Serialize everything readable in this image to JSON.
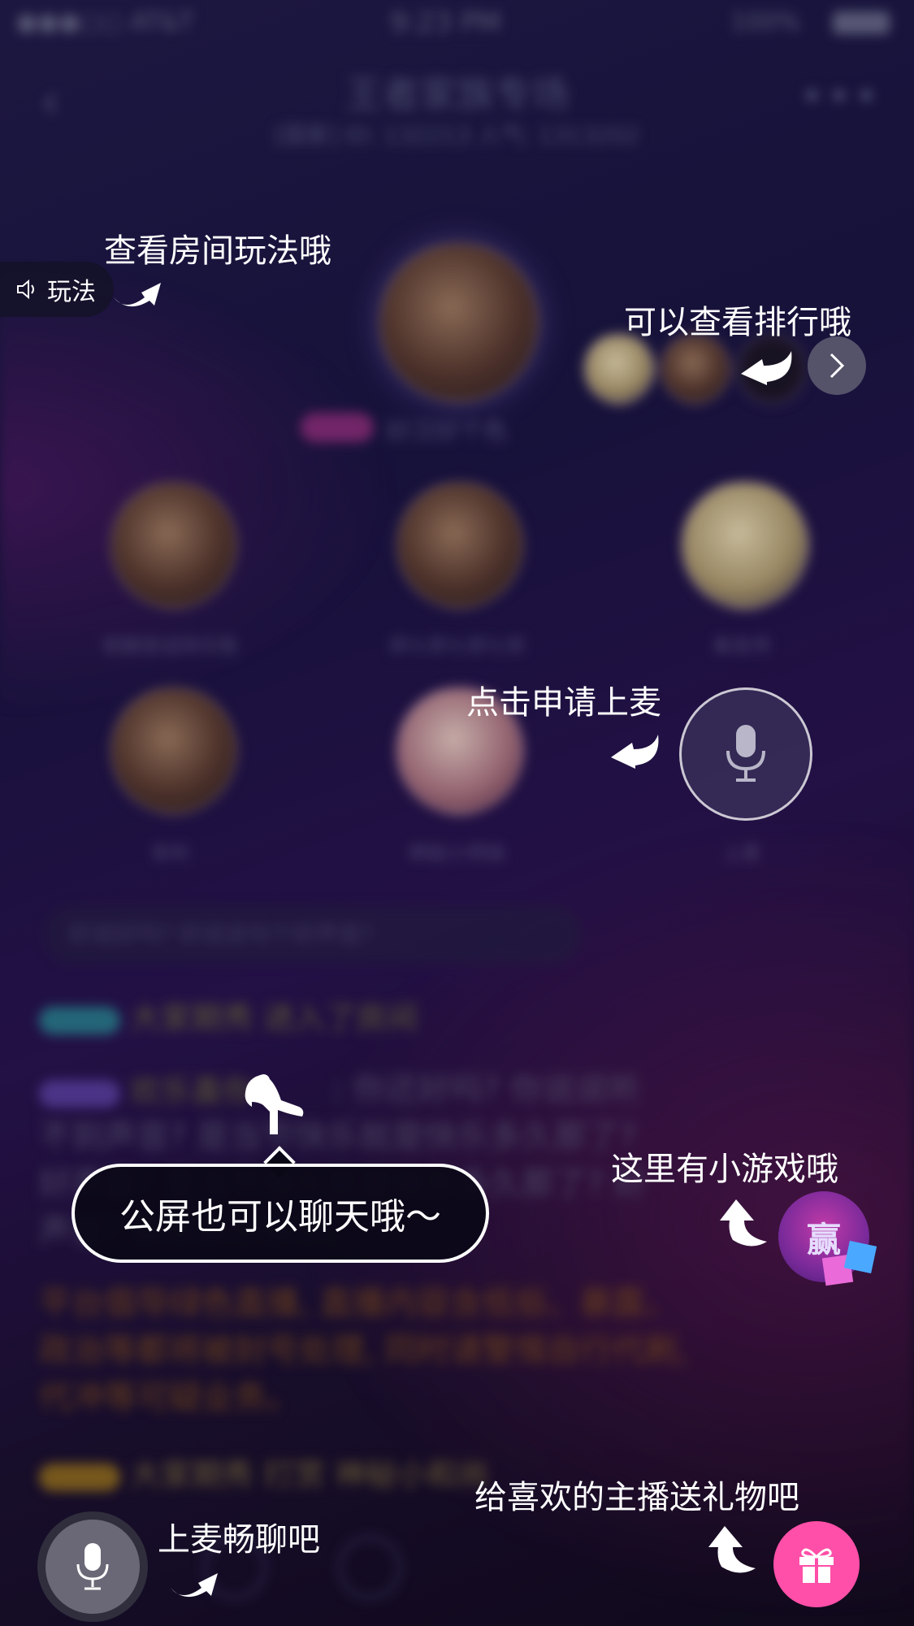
{
  "colors": {
    "background_top": "#221c4a",
    "background_bottom": "#120a1c",
    "tip_text": "#ffffff",
    "gift_button": "#ff4fa8",
    "rank_arrow_button": "#55536a"
  },
  "status_bar": {
    "carrier": "●●●○○ AT&T",
    "time": "9:23 PM",
    "battery": "100%"
  },
  "header": {
    "back_icon": "chevron-left-icon",
    "title": "王者家族专场",
    "subtitle": "[国家]  ID: 132213  人气: 1313202",
    "more_icon": "more-dots-icon"
  },
  "host": {
    "name": "好汉好个色"
  },
  "seats": [
    {
      "name": "就解放追除乐胜"
    },
    {
      "name": "郑七郑七郑七郑"
    },
    {
      "name": "美发师"
    },
    {
      "name": "安利"
    },
    {
      "name": "神秘小师妹"
    },
    {
      "name": "上麦"
    }
  ],
  "chat": {
    "welcome_bubble": "好说好吗? 好说说句个好声音?",
    "line1": "大家期秀  进入了房间",
    "line2_prefix": "欢乐喜你",
    "line2_text": ": 你还好吗? 你说说听不到声音? 是当节快乐就是快乐多久那了? 好声音? 是当节快乐就是快乐多久那了? 好声音? 快乐快乐快乐。",
    "system_notice": "平台倡导绿色直播, 直播内容含低俗、暴露、政治等都将被封号处理, 同时请警惕自行代刷, 代冲等可疑业务。",
    "line4": "大家期秀 打赏 神秘小和尚"
  },
  "guide": {
    "playway_pill": "玩法",
    "tip_playway": "查看房间玩法哦",
    "tip_rank": "可以查看排行哦",
    "tip_apply_mic": "点击申请上麦",
    "tip_public_chat": "公屏也可以聊天哦～",
    "tip_game": "这里有小游戏哦",
    "game_badge_label": "赢",
    "tip_gift": "给喜欢的主播送礼物吧",
    "tip_mic_bottom": "上麦畅聊吧"
  },
  "icons": {
    "speaker": "speaker-icon",
    "rank_more": "chevron-right-icon",
    "mic": "microphone-icon",
    "hand": "pointing-hand-icon",
    "gift": "gift-icon",
    "curved_arrow": "curved-arrow-icon"
  }
}
